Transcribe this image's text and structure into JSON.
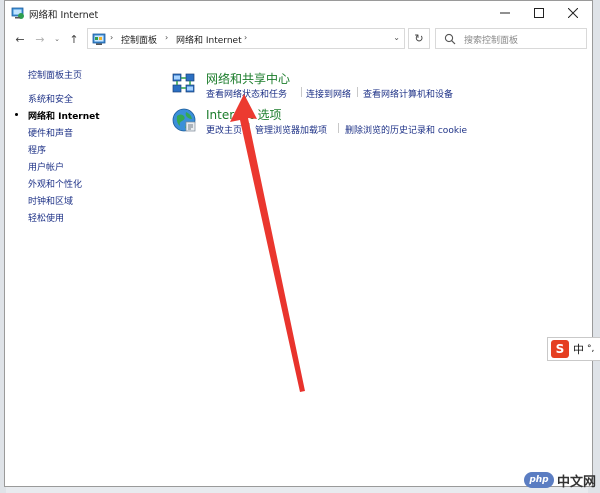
{
  "window": {
    "title": "网络和 Internet",
    "controls": {
      "minimize": "—",
      "maximize": "☐",
      "close": "✕"
    }
  },
  "toolbar": {
    "back_glyph": "←",
    "forward_glyph": "→",
    "recent_glyph": "⌄",
    "up_glyph": "↑",
    "refresh_glyph": "↻",
    "address": {
      "sep": "›",
      "crumbs": [
        "控制面板",
        "网络和 Internet"
      ],
      "dropdown_glyph": "⌄"
    },
    "search": {
      "placeholder": "搜索控制面板"
    }
  },
  "sidebar": {
    "home": "控制面板主页",
    "items": [
      {
        "label": "系统和安全"
      },
      {
        "label": "网络和 Internet",
        "current": true
      },
      {
        "label": "硬件和声音"
      },
      {
        "label": "程序"
      },
      {
        "label": "用户帐户"
      },
      {
        "label": "外观和个性化"
      },
      {
        "label": "时钟和区域"
      },
      {
        "label": "轻松使用"
      }
    ]
  },
  "categories": [
    {
      "title": "网络和共享中心",
      "icon": "network-sharing-center-icon",
      "links": [
        "查看网络状态和任务",
        "连接到网络",
        "查看网络计算机和设备"
      ]
    },
    {
      "title": "Internet 选项",
      "icon": "internet-options-globe-icon",
      "links": [
        "更改主页",
        "管理浏览器加载项",
        "删除浏览的历史记录和 cookie"
      ]
    }
  ],
  "overlay": {
    "ime": {
      "logo": "S",
      "lang": "中",
      "extra": "°,"
    },
    "watermark": {
      "logo": "php",
      "text": "中文网"
    }
  },
  "colors": {
    "link": "#1e3287",
    "category_title": "#1b7c2b",
    "arrow": "#e8322c"
  }
}
